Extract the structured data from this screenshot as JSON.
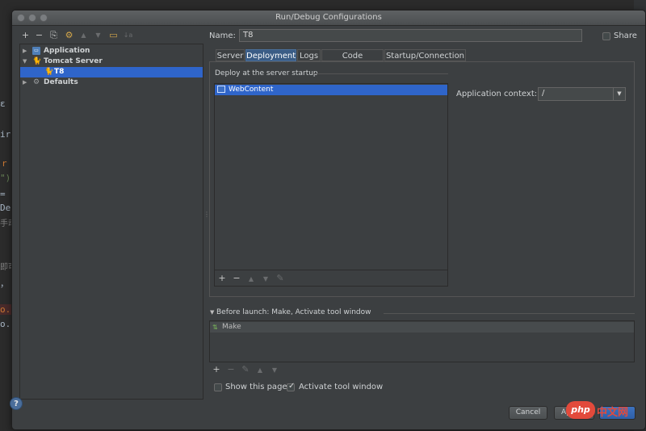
{
  "window": {
    "title": "Run/Debug Configurations"
  },
  "editor_fragments": [
    "ε",
    "ir",
    "r",
    "\")",
    "=",
    "De",
    "手动",
    "即可",
    "，",
    "o.c",
    "o.c"
  ],
  "toolbar": {
    "add": "+",
    "remove": "−",
    "copy": "⎘",
    "settings": "⚙",
    "up": "▲",
    "down": "▼",
    "folder": "▭",
    "sort": "↓a"
  },
  "tree": {
    "items": [
      {
        "label": "Application",
        "icon": "application-icon",
        "arrow": "▶"
      },
      {
        "label": "Tomcat Server",
        "icon": "tomcat-icon",
        "arrow": "▼"
      },
      {
        "label": "T8",
        "icon": "tomcat-icon"
      },
      {
        "label": "Defaults",
        "icon": "defaults-icon",
        "arrow": "▶"
      }
    ]
  },
  "form": {
    "name_label": "Name:",
    "name_value": "T8",
    "share_label": "Share"
  },
  "tabs": [
    {
      "label": "Server"
    },
    {
      "label": "Deployment"
    },
    {
      "label": "Logs"
    },
    {
      "label": "Code Coverage"
    },
    {
      "label": "Startup/Connection"
    }
  ],
  "deployment": {
    "group_title": "Deploy at the server startup",
    "artifacts": [
      {
        "label": "WebContent"
      }
    ],
    "list_toolbar": {
      "add": "+",
      "remove": "−",
      "up": "▲",
      "down": "▼",
      "edit": "✎"
    },
    "app_context_label": "Application context:",
    "app_context_value": "/"
  },
  "before_launch": {
    "title": "Before launch: Make, Activate tool window",
    "items": [
      {
        "label": "Make"
      }
    ],
    "toolbar": {
      "add": "+",
      "remove": "−",
      "edit": "✎",
      "up": "▲",
      "down": "▼"
    },
    "show_page_label": "Show this page",
    "show_page_checked": false,
    "activate_label": "Activate tool window",
    "activate_checked": true
  },
  "buttons": {
    "help": "?",
    "cancel": "Cancel",
    "apply": "App",
    "ok": ""
  },
  "watermark": {
    "logo": "php",
    "text": "中文网"
  }
}
